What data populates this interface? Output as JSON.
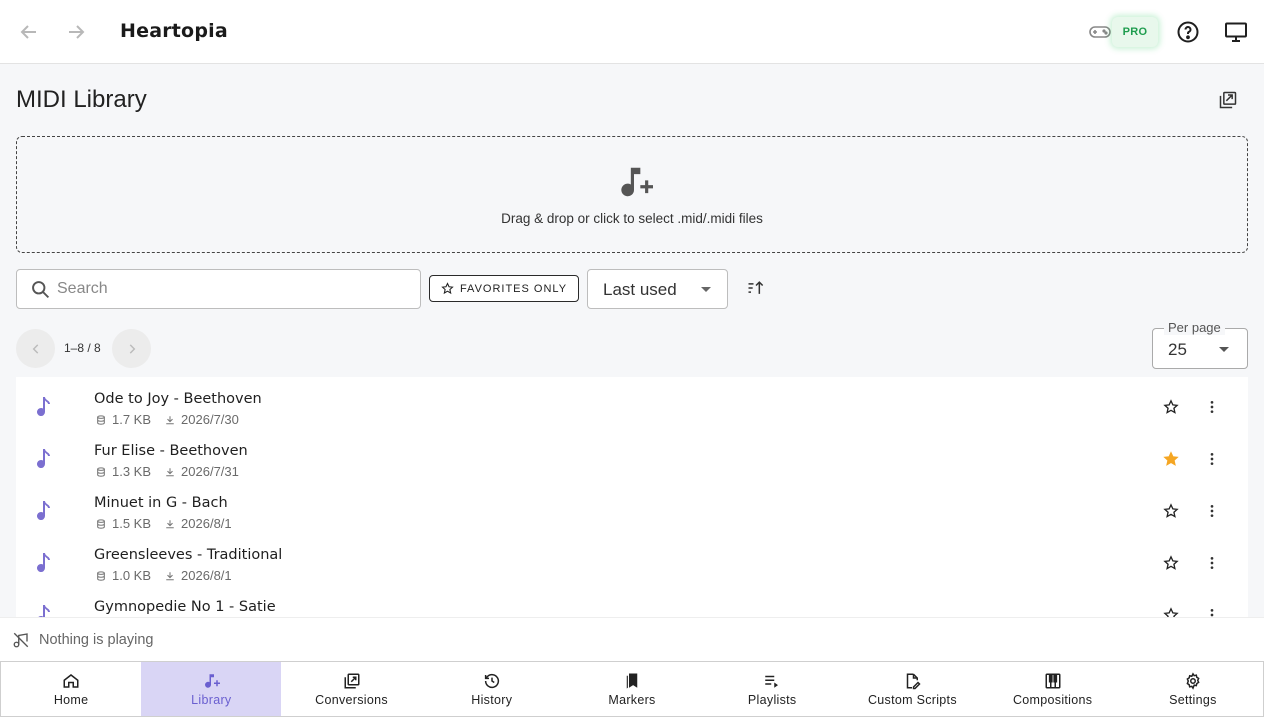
{
  "app": {
    "brand": "Heartopia",
    "pro_label": "PRO"
  },
  "page": {
    "title": "MIDI Library"
  },
  "dropzone": {
    "text": "Drag & drop or click to select .mid/.midi files"
  },
  "toolbar": {
    "search_placeholder": "Search",
    "favorites_label": "FAVORITES ONLY",
    "sort_value": "Last used"
  },
  "pagination": {
    "range": "1–8 / 8",
    "per_page_label": "Per page",
    "per_page_value": "25"
  },
  "songs": [
    {
      "name": "Ode to Joy - Beethoven",
      "size": "1.7 KB",
      "date": "2026/7/30",
      "favorite": false
    },
    {
      "name": "Fur Elise - Beethoven",
      "size": "1.3 KB",
      "date": "2026/7/31",
      "favorite": true
    },
    {
      "name": "Minuet in G - Bach",
      "size": "1.5 KB",
      "date": "2026/8/1",
      "favorite": false
    },
    {
      "name": "Greensleeves - Traditional",
      "size": "1.0 KB",
      "date": "2026/8/1",
      "favorite": false
    },
    {
      "name": "Gymnopedie No 1 - Satie",
      "size": "",
      "date": "",
      "favorite": false
    }
  ],
  "now_playing": {
    "text": "Nothing is playing"
  },
  "nav": [
    {
      "label": "Home",
      "icon": "home-icon"
    },
    {
      "label": "Library",
      "icon": "music-add-icon",
      "active": true
    },
    {
      "label": "Conversions",
      "icon": "conversions-icon"
    },
    {
      "label": "History",
      "icon": "history-icon"
    },
    {
      "label": "Markers",
      "icon": "bookmarks-icon"
    },
    {
      "label": "Playlists",
      "icon": "playlist-play-icon"
    },
    {
      "label": "Custom Scripts",
      "icon": "script-icon"
    },
    {
      "label": "Compositions",
      "icon": "piano-icon"
    },
    {
      "label": "Settings",
      "icon": "gear-icon"
    }
  ],
  "colors": {
    "accent": "#7b6fd0",
    "active_bg": "#d9d5f5",
    "favorite": "#f5a623",
    "pro_green": "#1f9d4f"
  }
}
